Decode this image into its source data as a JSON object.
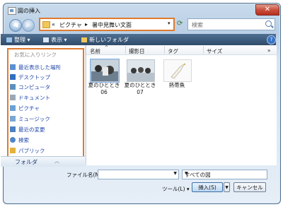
{
  "window": {
    "title": "図の挿入",
    "close_glyph": "✕"
  },
  "nav": {
    "back_glyph": "◀",
    "forward_glyph": "▶"
  },
  "address": {
    "prefix": "«",
    "crumb1": "ピクチャ",
    "sep": "▸",
    "crumb2": "暑中見舞い文面",
    "dropdown": "▾"
  },
  "search": {
    "placeholder": "検索"
  },
  "toolbar": {
    "organize": "整理",
    "views": "表示",
    "new_folder": "新しいフォルダ",
    "help": "?"
  },
  "left": {
    "favorites_title": "お気に入りリンク",
    "items": [
      {
        "label": "最近表示した場所",
        "icon": "recent-places-icon",
        "color": "#5a8fd0"
      },
      {
        "label": "デスクトップ",
        "icon": "desktop-icon",
        "color": "#2f6fc0"
      },
      {
        "label": "コンピュータ",
        "icon": "computer-icon",
        "color": "#5c8fbf"
      },
      {
        "label": "ドキュメント",
        "icon": "documents-icon",
        "color": "#9aa7b6"
      },
      {
        "label": "ピクチャ",
        "icon": "pictures-icon",
        "color": "#6aa0d6"
      },
      {
        "label": "ミュージック",
        "icon": "music-icon",
        "color": "#7aa7d2"
      },
      {
        "label": "最近の変更",
        "icon": "recent-changes-icon",
        "color": "#4c82c2"
      },
      {
        "label": "検索",
        "icon": "search-folder-icon",
        "color": "#4f86c6"
      },
      {
        "label": "パブリック",
        "icon": "public-folder-icon",
        "color": "#e3b23c"
      }
    ],
    "folders_label": "フォルダ",
    "folders_chevron": "︿"
  },
  "columns": [
    "名前",
    "撮影日",
    "タグ",
    "サイズ",
    "»"
  ],
  "files": [
    {
      "name": "夏のひととき",
      "line2": "06",
      "kind": "photo",
      "selected": true
    },
    {
      "name": "夏のひととき",
      "line2": "07",
      "kind": "photo",
      "selected": false
    },
    {
      "name": "熱帯魚",
      "line2": "",
      "kind": "clipart",
      "selected": false
    }
  ],
  "bottom": {
    "filename_label": "ファイル名(N):",
    "filename_value": "",
    "type_value": "すべての図",
    "tools_label": "ツール(L)",
    "insert_label": "挿入(S)",
    "cancel_label": "キャンセル"
  },
  "colors": {
    "highlight_box": "#e07a2c",
    "toolbar_bg": "#3d5c7e",
    "link_text": "#1f47a8"
  }
}
